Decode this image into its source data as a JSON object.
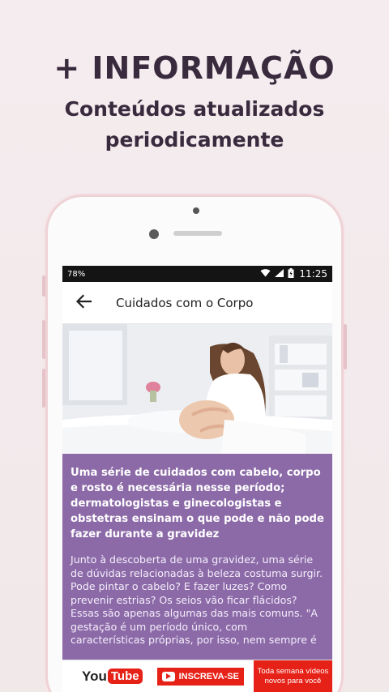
{
  "promo": {
    "title": "+ INFORMAÇÃO",
    "subtitle": "Conteúdos atualizados periodicamente"
  },
  "status_bar": {
    "battery": "78%",
    "time": "11:25"
  },
  "app_bar": {
    "back_icon": "arrow-back-icon",
    "title": "Cuidados com o Corpo"
  },
  "article": {
    "lead": "Uma série de cuidados com cabelo, corpo e rosto é necessária nesse período; dermatologistas e ginecologistas e obstetras ensinam o que pode e não pode fazer durante a gravidez",
    "body": "Junto à descoberta de uma gravidez, uma série de dúvidas relacionadas à beleza costuma surgir. Pode pintar o cabelo? E fazer luzes? Como prevenir estrias? Os seios vão ficar flácidos? Essas são apenas algumas das mais comuns. \"A gestação é um período único, com características próprias, por isso, nem sempre é"
  },
  "ad_banner": {
    "logo_you": "You",
    "logo_tube": "Tube",
    "subscribe_label": "INSCREVA-SE",
    "note": "Toda semana vídeos novos para você"
  },
  "colors": {
    "content_bg": "#8c6aa8",
    "promo_text": "#3a2a3e",
    "youtube_red": "#e62117"
  }
}
